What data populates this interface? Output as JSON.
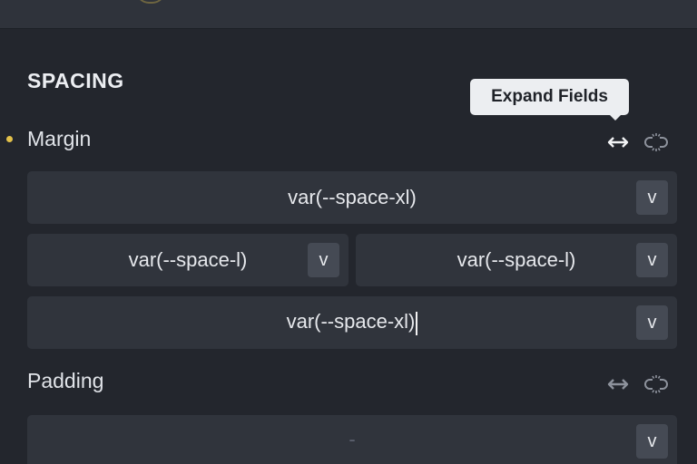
{
  "section": {
    "title": "SPACING"
  },
  "tooltip": {
    "text": "Expand Fields"
  },
  "margin": {
    "label": "Margin",
    "top": {
      "value": "var(--space-xl)",
      "unit": "v"
    },
    "left": {
      "value": "var(--space-l)",
      "unit": "v"
    },
    "right": {
      "value": "var(--space-l)",
      "unit": "v"
    },
    "bottom": {
      "value": "var(--space-xl)",
      "unit": "v"
    }
  },
  "padding": {
    "label": "Padding",
    "all": {
      "value": "-",
      "unit": "v"
    }
  },
  "icons": {
    "expand": "expand-fields-icon",
    "link": "unlink-icon"
  },
  "colors": {
    "background": "#23262d",
    "field": "#30343c",
    "modified_dot": "#e3c14a"
  }
}
